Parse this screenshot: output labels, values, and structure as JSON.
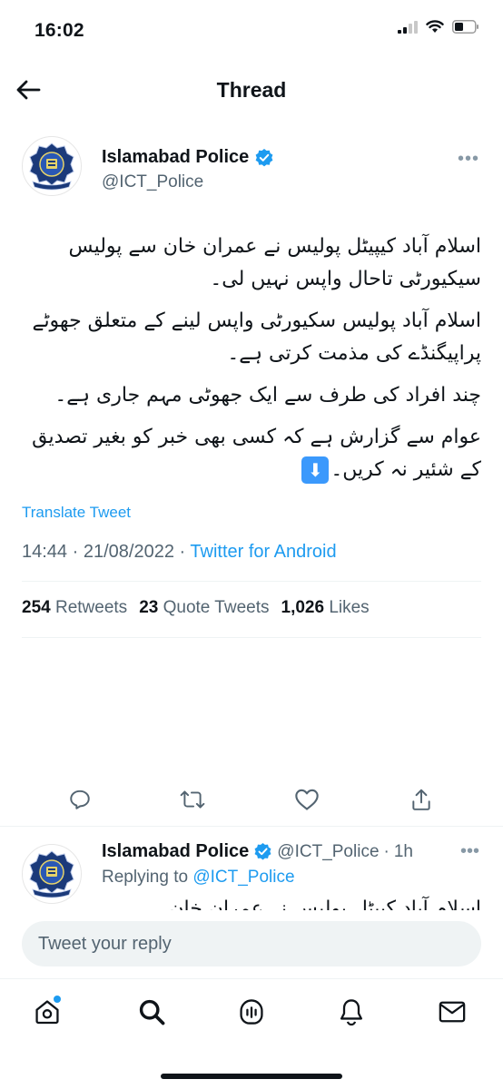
{
  "status_bar": {
    "time": "16:02"
  },
  "nav": {
    "title": "Thread"
  },
  "tweet": {
    "author_name": "Islamabad Police",
    "author_handle": "@ICT_Police",
    "paragraphs": [
      "اسلام آباد کیپیٹل پولیس نے عمران خان سے پولیس سیکیورٹی تاحال واپس نہیں لی۔",
      "اسلام آباد پولیس سکیورٹی واپس لینے کے متعلق جھوٹے پراپیگنڈے کی مذمت کرتی ہے۔",
      "چند افراد کی طرف سے ایک جھوٹی مہم جاری ہے۔",
      "عوام سے گزارش ہے کہ کسی بھی خبر کو بغیر تصدیق کے شئیر نہ کریں۔"
    ],
    "emoji": "⬇",
    "translate_label": "Translate Tweet",
    "time": "14:44",
    "date": "21/08/2022",
    "separator": "·",
    "source": "Twitter for Android",
    "stats": {
      "retweets_count": "254",
      "retweets_label": "Retweets",
      "quotes_count": "23",
      "quotes_label": "Quote Tweets",
      "likes_count": "1,026",
      "likes_label": "Likes"
    }
  },
  "reply": {
    "author_name": "Islamabad Police",
    "author_handle": "@ICT_Police",
    "separator": "·",
    "age": "1h",
    "replying_prefix": "Replying to",
    "replying_to": "@ICT_Police",
    "preview_text": "اسلام آباد کیپٹل پولیس نے عمران خان"
  },
  "reply_box": {
    "placeholder": "Tweet your reply"
  },
  "icons": {
    "back": "arrow-left-icon",
    "verified": "verified-badge-icon",
    "reply": "reply-icon",
    "retweet": "retweet-icon",
    "like": "heart-icon",
    "share": "share-icon",
    "home": "home-icon",
    "search": "search-icon",
    "spaces": "spaces-icon",
    "notifications": "bell-icon",
    "messages": "mail-icon"
  },
  "colors": {
    "accent": "#1d9bf0",
    "text": "#0f1419",
    "secondary": "#536471",
    "emoji_bg": "#3b99fc"
  }
}
